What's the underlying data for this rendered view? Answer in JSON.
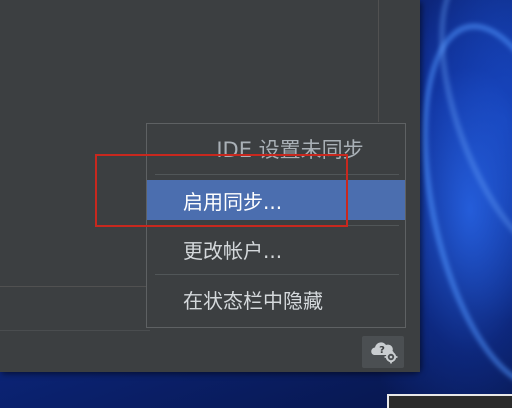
{
  "popup": {
    "header": "IDE 设置未同步",
    "items": [
      {
        "label": "启用同步..."
      },
      {
        "label": "更改帐户..."
      },
      {
        "label": "在状态栏中隐藏"
      }
    ],
    "selected_index": 0
  },
  "status_bar": {
    "sync_icon": "cloud-question-gear-icon"
  },
  "colors": {
    "ide_background": "#3c3f41",
    "selection": "#4b6eaf",
    "annotation": "#c8281e",
    "wallpaper": "#0b1d57"
  }
}
